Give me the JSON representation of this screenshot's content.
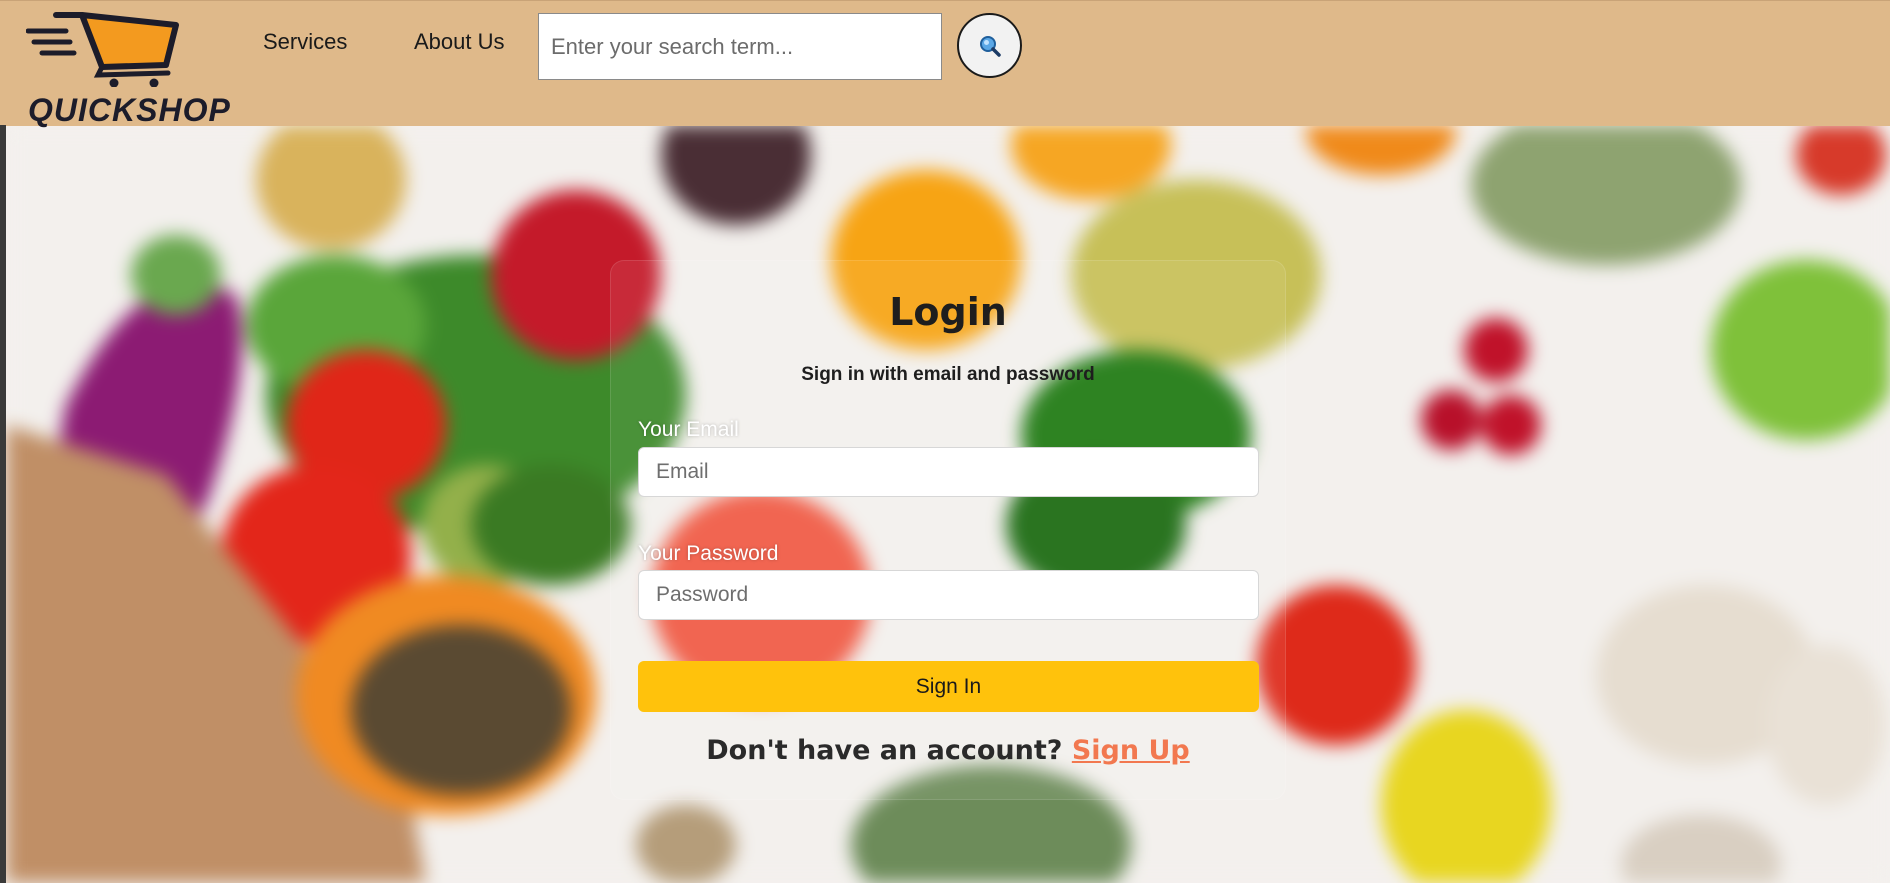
{
  "header": {
    "logo_text": "QUICKSHOP",
    "nav": {
      "services": "Services",
      "about": "About Us"
    },
    "search": {
      "placeholder": "Enter your search term...",
      "button_icon": "search-icon"
    }
  },
  "login": {
    "title": "Login",
    "subtitle": "Sign in with email and password",
    "email_label": "Your Email",
    "email_placeholder": "Email",
    "password_label": "Your Password",
    "password_placeholder": "Password",
    "signin_label": "Sign In",
    "no_account_text": "Don't have an account?",
    "signup_label": "Sign Up"
  },
  "colors": {
    "header_bg": "#dfb98a",
    "signin_button": "#ffc20c",
    "signup_link": "#f2784f"
  }
}
